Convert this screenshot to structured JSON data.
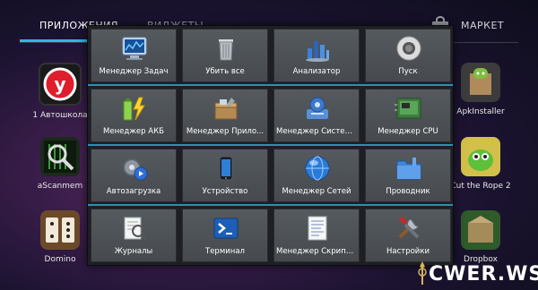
{
  "tabs": {
    "apps": "ПРИЛОЖЕНИЯ",
    "widgets": "ВИДЖЕТЫ",
    "market": "МАРКЕТ"
  },
  "background_apps": [
    {
      "label": "1 Автошкола"
    },
    {
      "label": "aScanmem"
    },
    {
      "label": "Domino"
    },
    {
      "label": "ApkInstaller"
    },
    {
      "label": "Cut the Rope 2"
    },
    {
      "label": "Dropbox"
    }
  ],
  "menu": [
    [
      {
        "label": "Менеджер Задач",
        "icon": "task-manager-icon"
      },
      {
        "label": "Убить все",
        "icon": "trash-bin-icon"
      },
      {
        "label": "Анализатор",
        "icon": "analyzer-icon"
      },
      {
        "label": "Пуск",
        "icon": "start-icon"
      }
    ],
    [
      {
        "label": "Менеджер АКБ",
        "icon": "battery-icon"
      },
      {
        "label": "Менеджер Прило...",
        "icon": "app-manager-icon"
      },
      {
        "label": "Менеджер Систем...",
        "icon": "system-manager-icon"
      },
      {
        "label": "Менеджер CPU",
        "icon": "cpu-icon"
      }
    ],
    [
      {
        "label": "Автозагрузка",
        "icon": "autostart-icon"
      },
      {
        "label": "Устройство",
        "icon": "device-icon"
      },
      {
        "label": "Менеджер Сетей",
        "icon": "network-icon"
      },
      {
        "label": "Проводник",
        "icon": "explorer-icon"
      }
    ],
    [
      {
        "label": "Журналы",
        "icon": "logs-icon"
      },
      {
        "label": "Терминал",
        "icon": "terminal-icon"
      },
      {
        "label": "Менеджер Скрипт...",
        "icon": "script-manager-icon"
      },
      {
        "label": "Настройки",
        "icon": "settings-icon"
      }
    ]
  ],
  "watermark": "CWER.WS"
}
